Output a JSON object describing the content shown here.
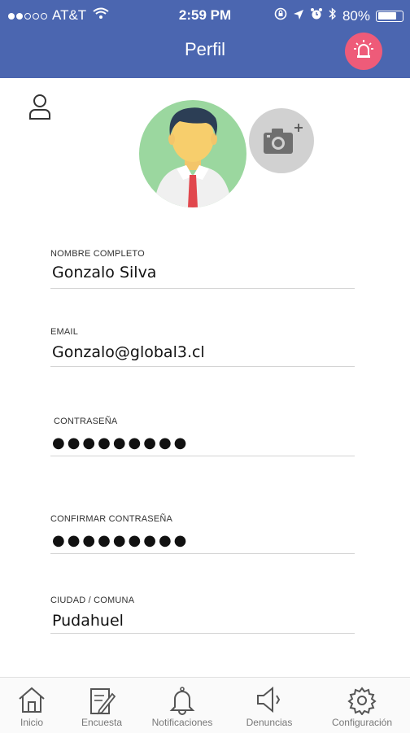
{
  "status_bar": {
    "carrier": "AT&T",
    "time": "2:59 PM",
    "battery": "80%",
    "battery_level": 0.8,
    "signal_bars": 2
  },
  "header": {
    "title": "Perfil",
    "alarm_button_icon": "alarm-siren-icon"
  },
  "profile": {
    "user_icon": "user-outline-icon",
    "avatar_icon": "avatar-man-tie",
    "camera_icon": "add-photo-camera-icon"
  },
  "fields": [
    {
      "label": "NOMBRE COMPLETO",
      "value": "Gonzalo Silva"
    },
    {
      "label": "EMAIL",
      "value": "Gonzalo@global3.cl"
    },
    {
      "label": "CONTRASEÑA",
      "value": "●●●●●●●●●"
    },
    {
      "label": "CONFIRMAR CONTRASEÑA",
      "value": "●●●●●●●●●"
    },
    {
      "label": "CIUDAD / COMUNA",
      "value": "Pudahuel"
    }
  ],
  "tabbar": [
    {
      "label": "Inicio",
      "icon": "home-icon"
    },
    {
      "label": "Encuesta",
      "icon": "survey-edit-icon"
    },
    {
      "label": "Notificaciones",
      "icon": "bell-icon"
    },
    {
      "label": "Denuncias",
      "icon": "megaphone-icon"
    },
    {
      "label": "Configuración",
      "icon": "gear-icon"
    }
  ],
  "colors": {
    "header": "#4b66b0",
    "alarm": "#ee5b79",
    "avatar_bg": "#9bd79f",
    "camera_bg": "#d1d1d1",
    "tie": "#e1474d"
  }
}
